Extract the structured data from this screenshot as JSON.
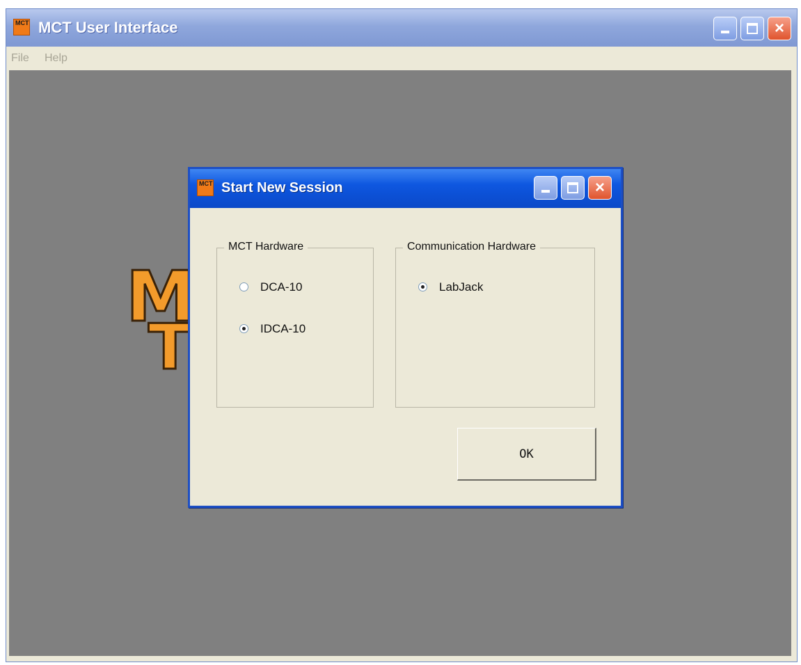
{
  "window": {
    "title": "MCT User Interface",
    "icon": "app-logo-icon",
    "icon_text": "MCT",
    "controls": [
      "minimize-icon",
      "maximize-icon",
      "close-icon"
    ]
  },
  "menu": {
    "items": [
      {
        "label": "File"
      },
      {
        "label": "Help"
      }
    ]
  },
  "logo": {
    "row1": "M     OL",
    "row2": "T     S"
  },
  "dialog": {
    "title": "Start New Session",
    "icon": "app-logo-icon",
    "icon_text": "MCT",
    "mct_hardware": {
      "label": "MCT Hardware",
      "options": [
        {
          "label": "DCA-10",
          "checked": false
        },
        {
          "label": "IDCA-10",
          "checked": true
        }
      ]
    },
    "communication_hardware": {
      "label": "Communication Hardware",
      "options": [
        {
          "label": "LabJack",
          "checked": true
        }
      ]
    },
    "ok_label": "OK"
  },
  "colors": {
    "main_title_bar": "#8fa7dc",
    "dialog_title_bar": "#0e57e0",
    "workspace": "#808080",
    "logo_orange": "#f39b2b",
    "face": "#ece9d8"
  }
}
